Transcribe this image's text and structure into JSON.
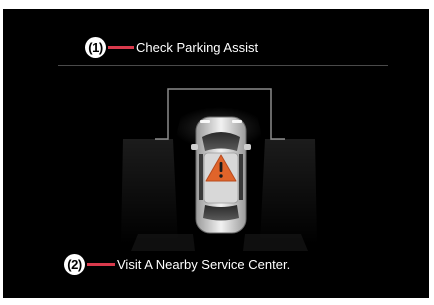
{
  "callouts": [
    {
      "number": "(1)",
      "text": "Check Parking Assist"
    },
    {
      "number": "(2)",
      "text": "Visit A Nearby Service Center."
    }
  ],
  "warning_icon": "warning-triangle-icon",
  "colors": {
    "background": "#000000",
    "leader_line": "#d93a4c",
    "warning": "#e0642a"
  }
}
